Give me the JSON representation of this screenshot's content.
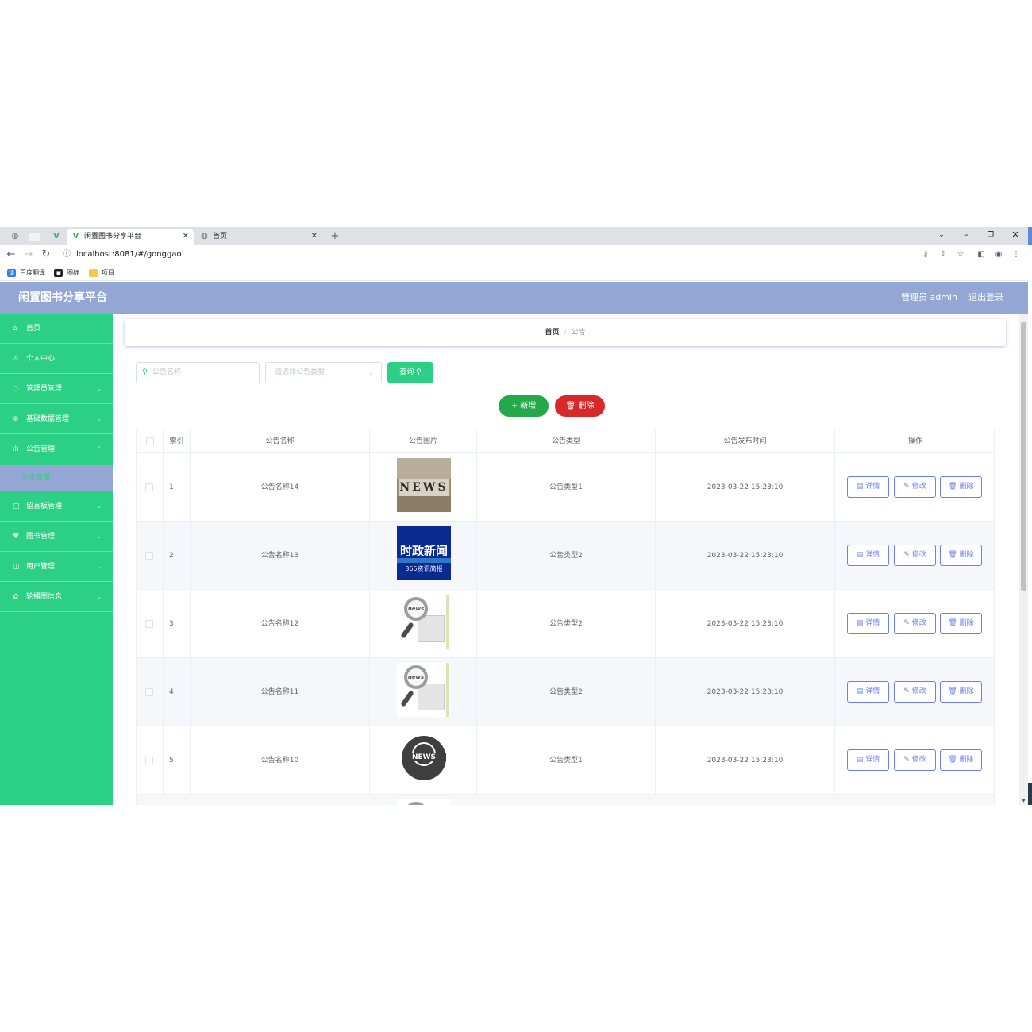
{
  "browser": {
    "tabs": [
      {
        "title": "闲置图书分享平台",
        "active": true
      },
      {
        "title": "首页",
        "active": false
      }
    ],
    "new_tab": "+",
    "url": "localhost:8081/#/gonggao",
    "bookmarks": [
      {
        "label": "百度翻译",
        "color": "#2d7ff9",
        "glyph": "译"
      },
      {
        "label": "图标",
        "color": "#1f1f1f",
        "glyph": "▣"
      },
      {
        "label": "项目",
        "color": "#f7c948",
        "glyph": ""
      }
    ]
  },
  "header": {
    "app_title": "闲置图书分享平台",
    "user_label": "管理员 admin",
    "logout_label": "退出登录",
    "color": "#94a6d3"
  },
  "sidebar": {
    "color": "#2bd084",
    "items": [
      {
        "label": "首页",
        "icon": "home-icon"
      },
      {
        "label": "个人中心",
        "icon": "user-icon"
      },
      {
        "label": "管理员管理",
        "icon": "admin-icon"
      },
      {
        "label": "基础数据管理",
        "icon": "data-icon"
      },
      {
        "label": "公告管理",
        "icon": "notice-icon"
      },
      {
        "label": "公告管理",
        "icon": "",
        "sub": true
      },
      {
        "label": "留言板管理",
        "icon": "message-icon"
      },
      {
        "label": "图书管理",
        "icon": "book-icon"
      },
      {
        "label": "用户管理",
        "icon": "users-icon"
      },
      {
        "label": "轮播图信息",
        "icon": "carousel-icon"
      }
    ]
  },
  "breadcrumb": {
    "home": "首页",
    "separator": "/",
    "current": "公告"
  },
  "filters": {
    "name_placeholder": "公告名称",
    "type_placeholder": "请选择公告类型",
    "query_label": "查询"
  },
  "actions": {
    "add_label": "新增",
    "delete_label": "删除"
  },
  "table": {
    "columns": [
      "索引",
      "公告名称",
      "公告图片",
      "公告类型",
      "公告发布时间",
      "操作"
    ],
    "row_buttons": {
      "detail": "详情",
      "edit": "修改",
      "delete": "删除"
    },
    "rows": [
      {
        "index": "1",
        "name": "公告名称14",
        "image": "news-tiles",
        "type": "公告类型1",
        "time": "2023-03-22 15:23:10"
      },
      {
        "index": "2",
        "name": "公告名称13",
        "image": "politics-news",
        "type": "公告类型2",
        "time": "2023-03-22 15:23:10"
      },
      {
        "index": "3",
        "name": "公告名称12",
        "image": "magnifier-news",
        "type": "公告类型2",
        "time": "2023-03-22 15:23:10"
      },
      {
        "index": "4",
        "name": "公告名称11",
        "image": "magnifier-news",
        "type": "公告类型2",
        "time": "2023-03-22 15:23:10"
      },
      {
        "index": "5",
        "name": "公告名称10",
        "image": "globe-news",
        "type": "公告类型1",
        "time": "2023-03-22 15:23:10"
      }
    ]
  },
  "images_text": {
    "news_tiles": "NEWS",
    "politics_big": "时政新闻",
    "politics_small": "365资讯简报",
    "magnifier": "news",
    "globe": "NEWS"
  }
}
